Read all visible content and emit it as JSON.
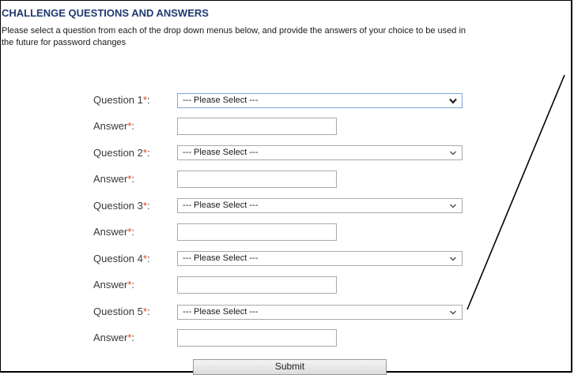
{
  "header": {
    "title": "CHALLENGE QUESTIONS AND ANSWERS",
    "intro_line1": "Please select a question from each of the drop down menus below, and provide the answers of your choice to be used in",
    "intro_line2": "the future for password changes"
  },
  "form": {
    "required_marker": "*",
    "colon": ":",
    "rows": [
      {
        "question_label": "Question 1",
        "select_value": "--- Please Select ---",
        "answer_label": "Answer",
        "answer_value": ""
      },
      {
        "question_label": "Question 2",
        "select_value": "--- Please Select ---",
        "answer_label": "Answer",
        "answer_value": ""
      },
      {
        "question_label": "Question 3",
        "select_value": "--- Please Select ---",
        "answer_label": "Answer",
        "answer_value": ""
      },
      {
        "question_label": "Question 4",
        "select_value": "--- Please Select ---",
        "answer_label": "Answer",
        "answer_value": ""
      },
      {
        "question_label": "Question 5",
        "select_value": "--- Please Select ---",
        "answer_label": "Answer",
        "answer_value": ""
      }
    ],
    "submit_label": "Submit"
  },
  "colors": {
    "title": "#1f3a70",
    "required": "#e0401a",
    "focused_border": "#7aa7d6"
  },
  "icons": {
    "select_arrow": "chevron-down-icon"
  }
}
